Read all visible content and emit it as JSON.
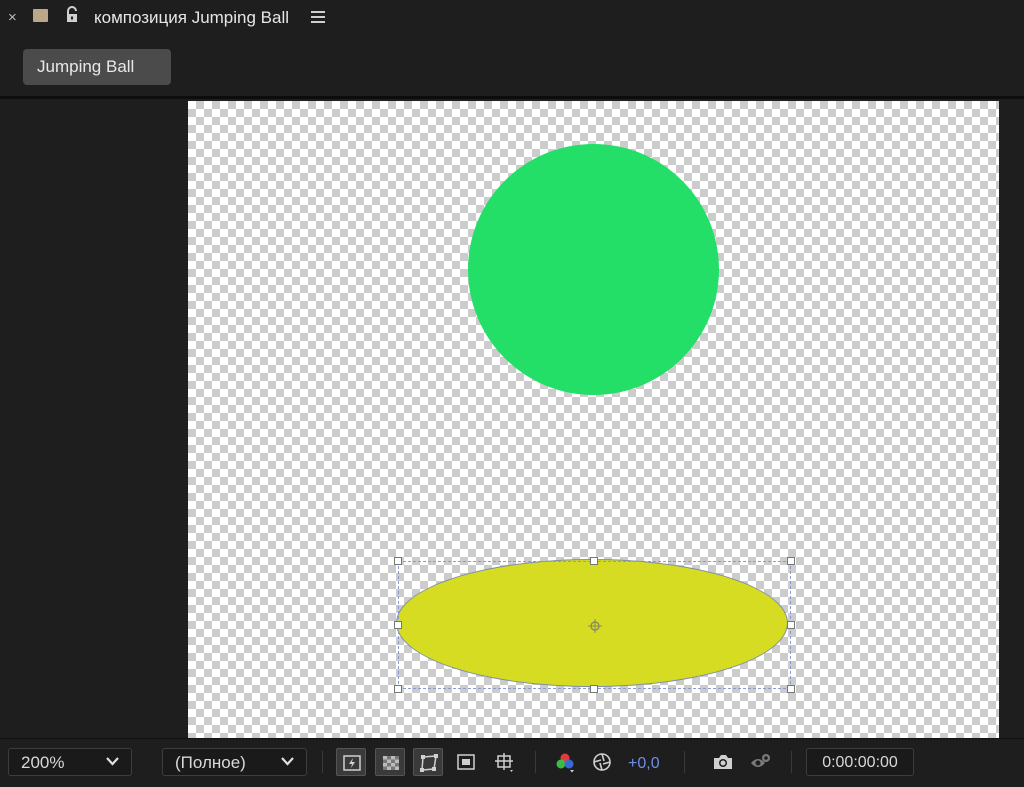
{
  "titlebar": {
    "close_glyph": "×",
    "label_color": "#b9a98a",
    "title": "композиция Jumping Ball",
    "icons": [
      "close-icon",
      "label-color-swatch",
      "unlock-icon",
      "hamburger-menu-icon"
    ]
  },
  "comp_tab": {
    "label": "Jumping Ball"
  },
  "canvas": {
    "background": "transparency-checkerboard",
    "layers": [
      {
        "name": "ball",
        "shape": "circle",
        "color": "#23de67",
        "selected": false
      },
      {
        "name": "shadow",
        "shape": "ellipse",
        "color": "#d6dc22",
        "selected": true
      }
    ]
  },
  "toolbar": {
    "zoom": "200%",
    "resolution": "(Полное)",
    "exposure": "+0,0",
    "timecode": "0:00:00:00",
    "icons": [
      "fast-previews-icon",
      "transparency-grid-icon",
      "mask-path-visibility-icon",
      "region-of-interest-icon",
      "grid-guides-icon",
      "color-channels-icon",
      "reset-exposure-icon",
      "snapshot-camera-icon",
      "show-snapshot-icon"
    ]
  }
}
